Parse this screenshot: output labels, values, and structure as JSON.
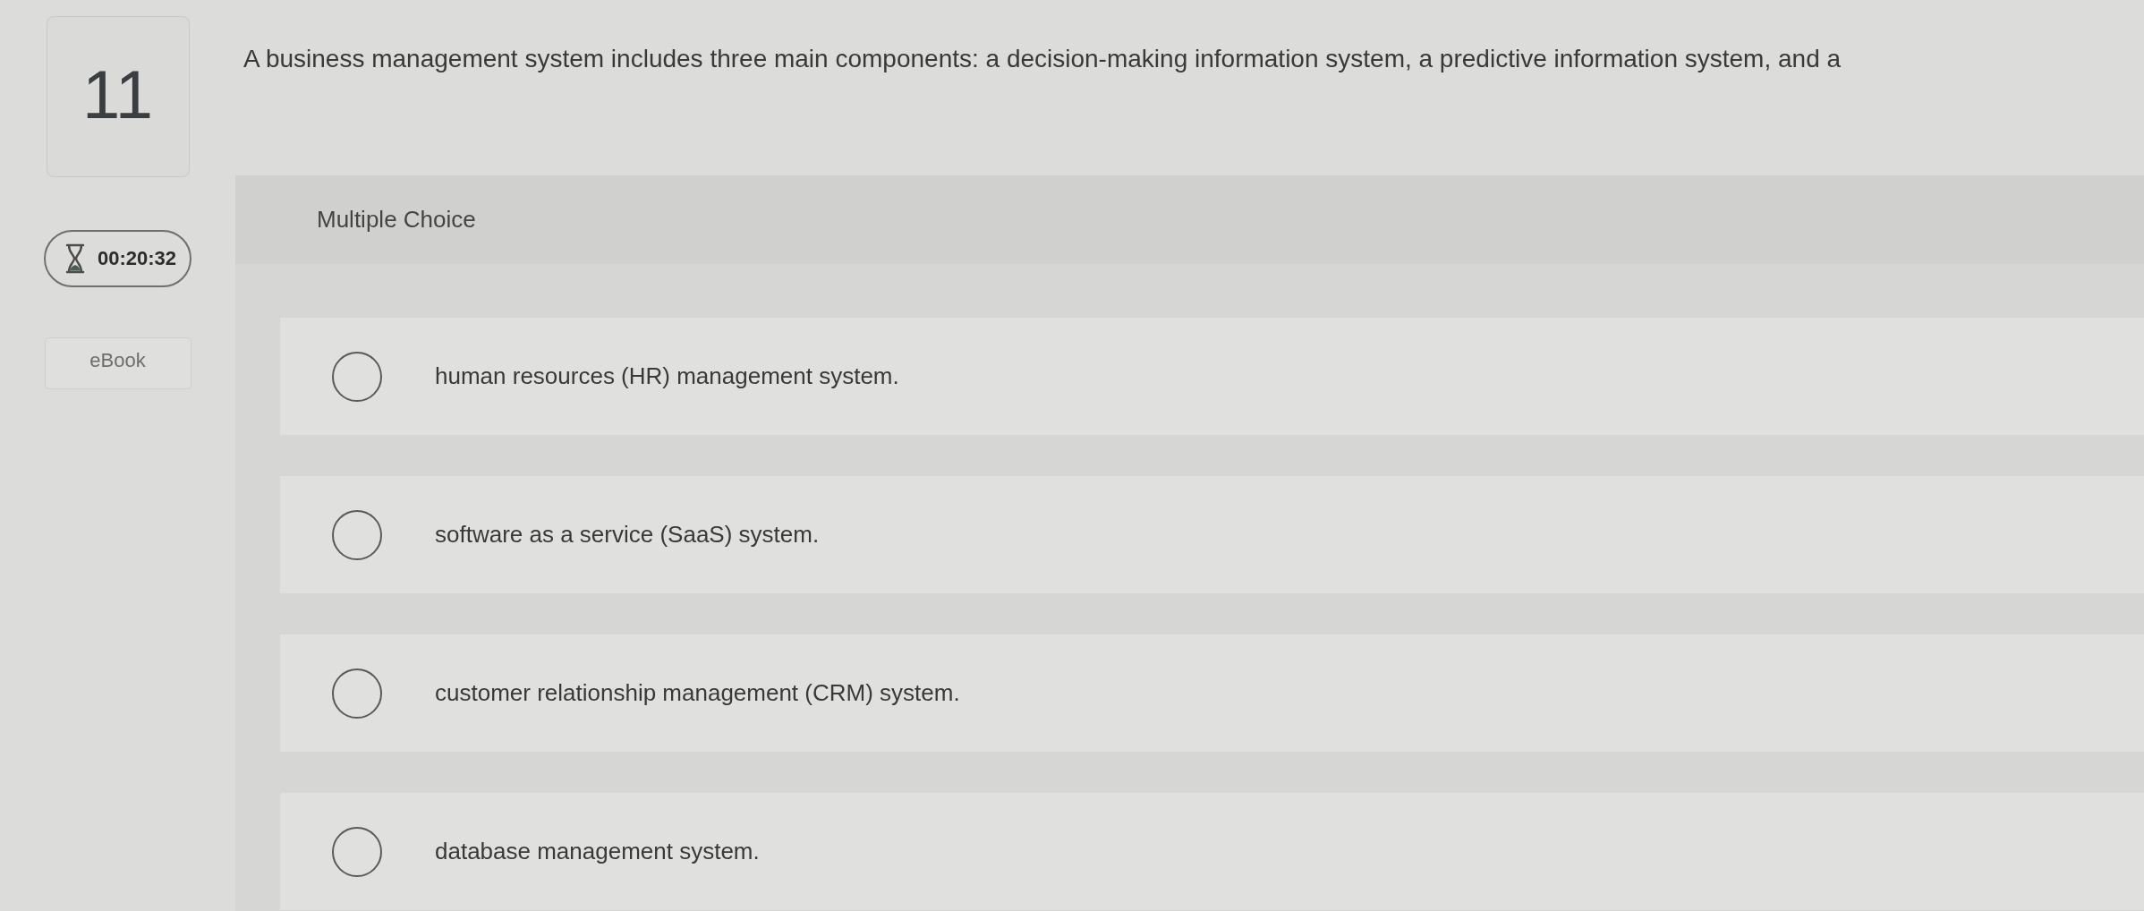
{
  "question": {
    "number": "11",
    "timer": "00:20:32",
    "ebook_button": "eBook",
    "text": "A business management system includes three main components: a decision-making information system, a predictive information system, and a"
  },
  "answer_panel": {
    "type_label": "Multiple Choice",
    "options": [
      {
        "label": "human resources (HR) management system.",
        "selected": false
      },
      {
        "label": "software as a service (SaaS) system.",
        "selected": false
      },
      {
        "label": "customer relationship management (CRM) system.",
        "selected": false
      },
      {
        "label": "database management system.",
        "selected": false
      }
    ]
  }
}
